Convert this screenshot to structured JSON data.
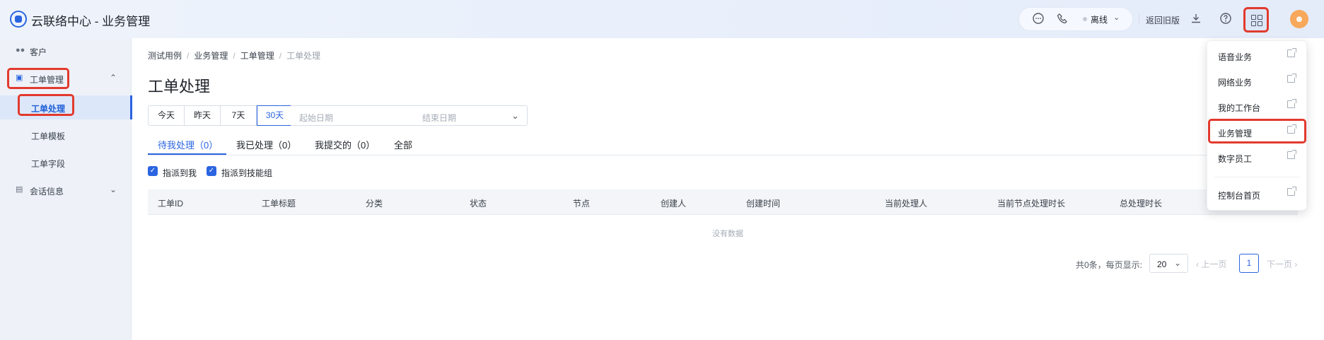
{
  "app": {
    "title": "云联络中心 - 业务管理"
  },
  "header": {
    "status": "离线",
    "old_version": "返回旧版",
    "icons": [
      "chat-icon",
      "phone-icon",
      "download-icon",
      "help-icon",
      "apps-grid-icon"
    ]
  },
  "sidebar": {
    "customer": "客户",
    "ticket_group": "工单管理",
    "ticket_items": [
      "工单处理",
      "工单模板",
      "工单字段"
    ],
    "session": "会话信息"
  },
  "breadcrumb": [
    "测试用例",
    "业务管理",
    "工单管理",
    "工单处理"
  ],
  "page_title": "工单处理",
  "date_filter": {
    "options": [
      "今天",
      "昨天",
      "7天",
      "30天"
    ],
    "selected": "30天",
    "start_placeholder": "起始日期",
    "end_placeholder": "结束日期"
  },
  "tabs": [
    "待我处理（0）",
    "我已处理（0）",
    "我提交的（0）",
    "全部"
  ],
  "checkboxes": [
    "指派到我",
    "指派到技能组"
  ],
  "table": {
    "columns": [
      "工单ID",
      "工单标题",
      "分类",
      "状态",
      "节点",
      "创建人",
      "创建时间",
      "当前处理人",
      "当前节点处理时长",
      "总处理时长"
    ],
    "empty_text": "没有数据"
  },
  "pager": {
    "total": "共0条，每页显示:",
    "page_size": "20",
    "prev": "上一页",
    "page": "1",
    "next": "下一页"
  },
  "dropdown": {
    "items": [
      "语音业务",
      "网络业务",
      "我的工作台",
      "业务管理",
      "数字员工",
      "控制台首页"
    ]
  },
  "colors": {
    "accent": "#2a64e0",
    "highlight": "#e23a2e"
  }
}
